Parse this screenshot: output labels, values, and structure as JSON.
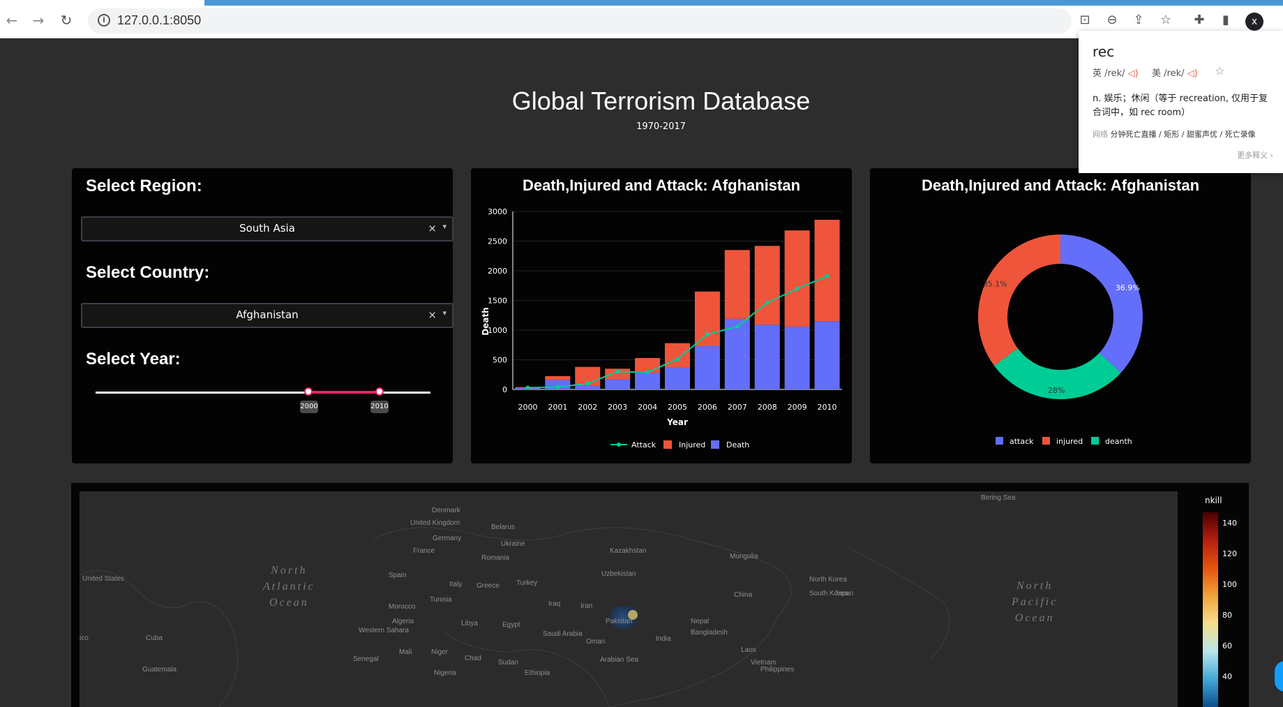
{
  "browser": {
    "url": "127.0.0.1:8050",
    "avatar_letter": "x"
  },
  "header": {
    "title": "Global Terrorism Database",
    "subtitle": "1970-2017"
  },
  "filters": {
    "region_label": "Select Region:",
    "region_value": "South Asia",
    "country_label": "Select Country:",
    "country_value": "Afghanistan",
    "year_label": "Select Year:",
    "year_start": "2000",
    "year_end": "2010",
    "clear_symbol": "×",
    "arrow_symbol": "▾"
  },
  "bar_chart": {
    "title": "Death,Injured and Attack: Afghanistan"
  },
  "pie_chart": {
    "title": "Death,Injured and Attack: Afghanistan"
  },
  "chart_data": [
    {
      "type": "bar",
      "title": "Death,Injured and Attack: Afghanistan",
      "xlabel": "Year",
      "ylabel": "Death",
      "categories": [
        "2000",
        "2001",
        "2002",
        "2003",
        "2004",
        "2005",
        "2006",
        "2007",
        "2008",
        "2009",
        "2010"
      ],
      "ylim": [
        0,
        3000
      ],
      "yticks": [
        0,
        500,
        1000,
        1500,
        2000,
        2500,
        3000
      ],
      "stacked": true,
      "series": [
        {
          "name": "Death",
          "kind": "bar",
          "color": "#636efa",
          "values": [
            30,
            160,
            60,
            170,
            280,
            370,
            730,
            1190,
            1090,
            1060,
            1150
          ]
        },
        {
          "name": "Injured",
          "kind": "bar",
          "color": "#ef553b",
          "values": [
            10,
            65,
            320,
            180,
            250,
            410,
            920,
            1160,
            1330,
            1620,
            1710
          ]
        },
        {
          "name": "Attack",
          "kind": "line",
          "color": "#00cc96",
          "values": [
            30,
            40,
            100,
            300,
            290,
            510,
            930,
            1060,
            1460,
            1700,
            1910
          ]
        }
      ],
      "grid": true,
      "legend_placement": "bottom"
    },
    {
      "type": "pie",
      "title": "Death,Injured and Attack: Afghanistan",
      "hole": true,
      "slices": [
        {
          "label": "attack",
          "value": 36.9,
          "text": "36.9%",
          "color": "#636efa"
        },
        {
          "label": "deanth",
          "value": 28.0,
          "text": "28%",
          "color": "#00cc96"
        },
        {
          "label": "injured",
          "value": 35.1,
          "text": "35.1%",
          "color": "#ef553b"
        }
      ],
      "legend": [
        "attack",
        "injured",
        "deanth"
      ],
      "legend_placement": "bottom"
    }
  ],
  "map": {
    "labels": [
      "United Kingdom",
      "Denmark",
      "Belarus",
      "Germany",
      "Ukraine",
      "France",
      "Romania",
      "Kazakhstan",
      "Mongolia",
      "Spain",
      "Uzbekistan",
      "Italy",
      "Greece",
      "Turkey",
      "North Korea",
      "South Korea",
      "Japan",
      "China",
      "Iraq",
      "Iran",
      "Tunisia",
      "Morocco",
      "Algeria",
      "Libya",
      "Egypt",
      "Saudi Arabia",
      "Pakistan",
      "Nepal",
      "Bangladesh",
      "India",
      "Oman",
      "Mali",
      "Niger",
      "Chad",
      "Sudan",
      "Senegal",
      "Nigeria",
      "Ethiopia",
      "Laos",
      "Vietnam",
      "Philippines",
      "United States",
      "Cuba",
      "Western Sahara",
      "Arabian Sea",
      "Bering Sea",
      "ico",
      "Guatemala"
    ],
    "oceans": [
      "North Atlantic Ocean",
      "North Pacific Ocean"
    ],
    "colorbar_title": "nkill",
    "colorbar_ticks": [
      "140",
      "120",
      "100",
      "80",
      "60",
      "40"
    ]
  },
  "dictionary_popup": {
    "word": "rec",
    "uk_label": "英",
    "uk_phonetic": "/rek/",
    "us_label": "美",
    "us_phonetic": "/rek/",
    "definition": "n. 娱乐；休闲（等于 recreation, 仅用于复合词中，如 rec room）",
    "web_label": "网络",
    "web_meanings": "分钟死亡直播 / 矩形 / 甜蜜声优 / 死亡录像",
    "more": "更多释义 ›"
  }
}
